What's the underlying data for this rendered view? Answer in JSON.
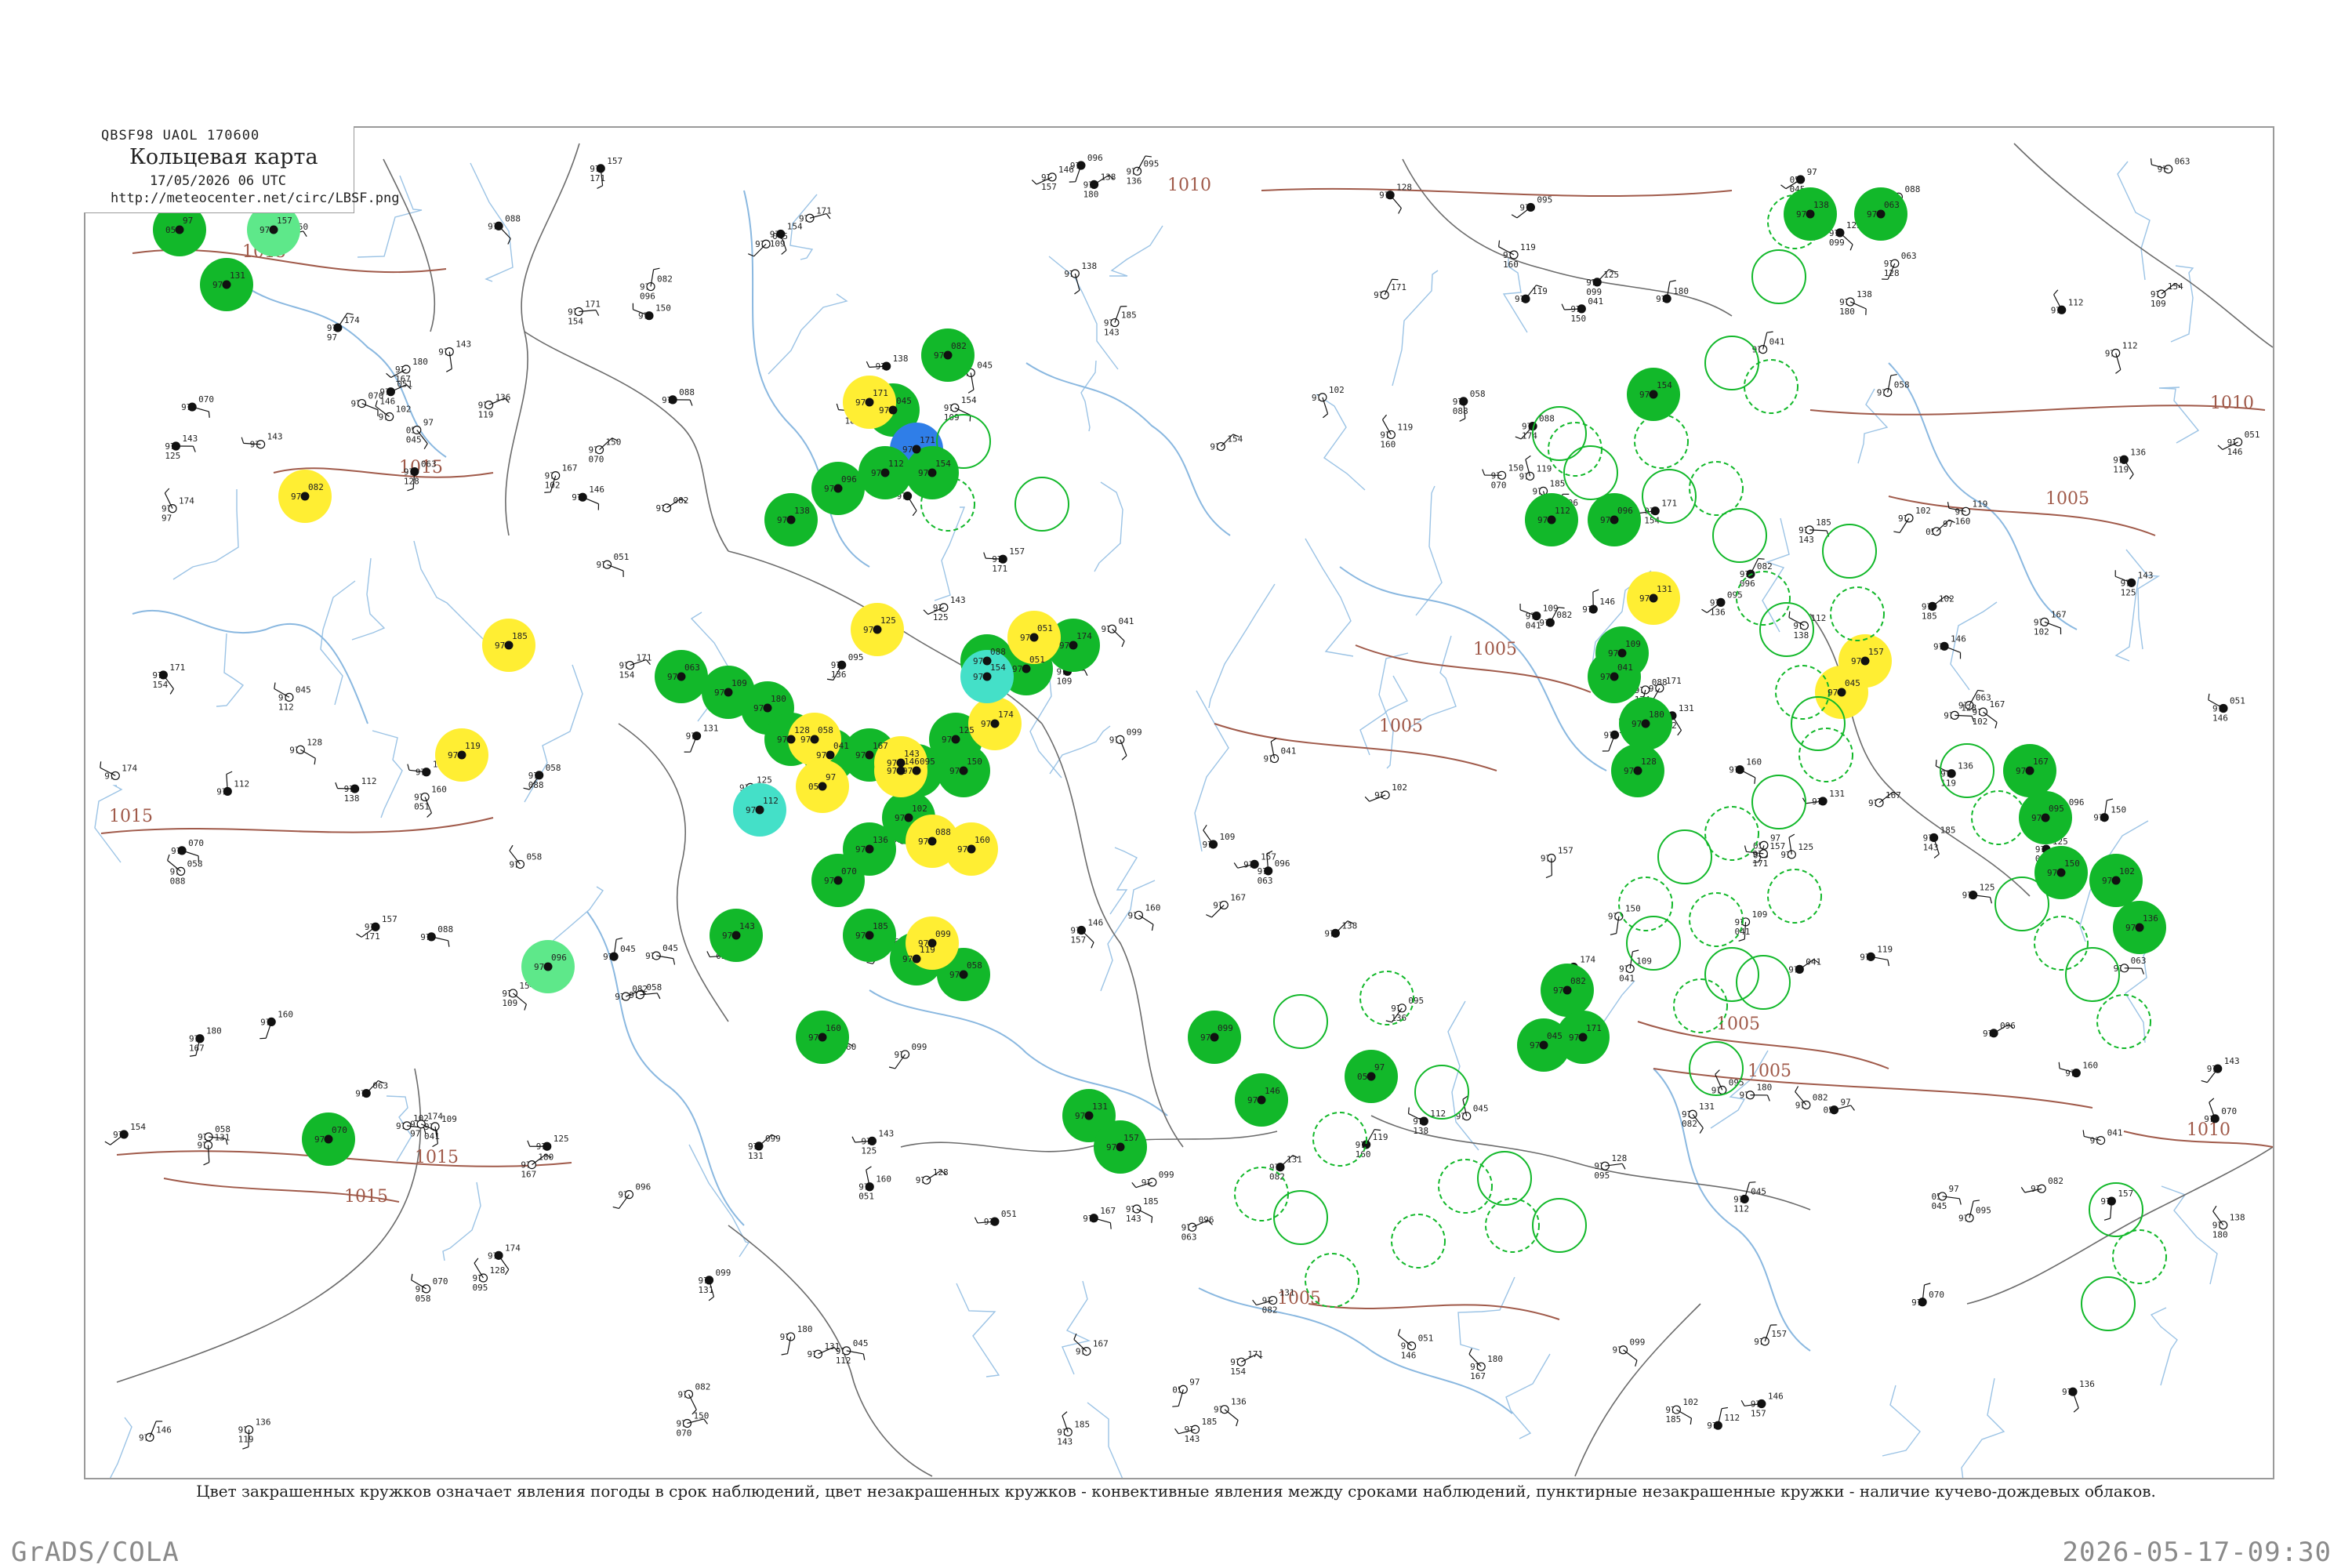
{
  "header": {
    "code": "QBSF98  UAOL  170600",
    "title": "Кольцевая карта",
    "date": "17/05/2026 06 UTC",
    "url": "http://meteocenter.net/circ/LBSF.png"
  },
  "caption": "Цвет закрашенных кружков означает явления погоды в срок наблюдений, цвет незакрашенных кружков - конвективные явления между сроками наблюдений, пунктирные незакрашенные кружки - наличие кучево-дождевых облаков.",
  "footer": {
    "left": "GrADS/COLA",
    "right": "2026-05-17-09:30"
  },
  "colors": {
    "rain": "#12b82a",
    "fog": "#ffee33",
    "snow": "#2f7ee8",
    "drizzle": "#44e0c8",
    "showers": "#5ee88a",
    "isobar": "#a05a4a",
    "border": "#6b6b6b",
    "water": "#8ab8e0"
  },
  "isobars": [
    "1015",
    "1015",
    "1015",
    "1015",
    "1010",
    "1010",
    "1005",
    "1005",
    "1005",
    "1005",
    "1005",
    "1005",
    "1010",
    "1015"
  ],
  "stations": [
    {
      "a": "97",
      "b": "05"
    },
    {
      "a": "131",
      "b": "97"
    },
    {
      "a": "157",
      "b": "97"
    },
    {
      "a": "045",
      "b": "97"
    },
    {
      "a": "082",
      "b": "97"
    },
    {
      "a": "171",
      "b": "97"
    },
    {
      "a": "112",
      "b": "97"
    },
    {
      "a": "096",
      "b": "97"
    },
    {
      "a": "154",
      "b": "97"
    },
    {
      "a": "138",
      "b": "97"
    },
    {
      "a": "063",
      "b": "97"
    },
    {
      "a": "109",
      "b": "97"
    },
    {
      "a": "180",
      "b": "97"
    },
    {
      "a": "128",
      "b": "97"
    },
    {
      "a": "041",
      "b": "97"
    },
    {
      "a": "167",
      "b": "97"
    },
    {
      "a": "095",
      "b": "97"
    },
    {
      "a": "150",
      "b": "97"
    },
    {
      "a": "102",
      "b": "97"
    },
    {
      "a": "136",
      "b": "97"
    },
    {
      "a": "070",
      "b": "97"
    },
    {
      "a": "185",
      "b": "97"
    },
    {
      "a": "119",
      "b": "97"
    },
    {
      "a": "058",
      "b": "97"
    },
    {
      "a": "143",
      "b": "97"
    },
    {
      "a": "160",
      "b": "97"
    },
    {
      "a": "088",
      "b": "97"
    },
    {
      "a": "125",
      "b": "97"
    },
    {
      "a": "051",
      "b": "97"
    },
    {
      "a": "174",
      "b": "97"
    },
    {
      "a": "099",
      "b": "97"
    },
    {
      "a": "146",
      "b": "97"
    }
  ]
}
